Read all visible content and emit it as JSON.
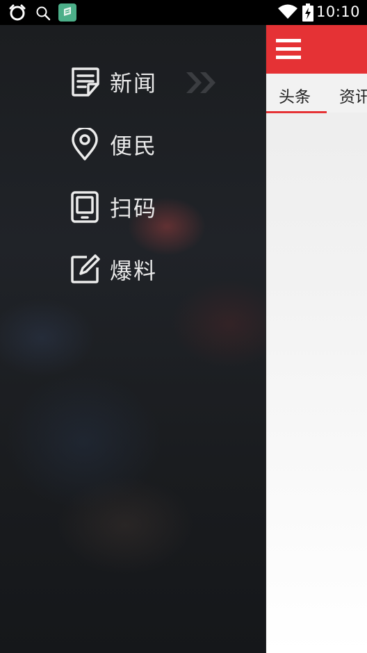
{
  "status_bar": {
    "time": "10:10",
    "icons": [
      "alarm-clock-icon",
      "search-icon",
      "app-notification-icon",
      "wifi-icon",
      "battery-charging-icon"
    ]
  },
  "drawer": {
    "items": [
      {
        "label": "新闻",
        "icon": "news-icon",
        "active": true
      },
      {
        "label": "便民",
        "icon": "location-pin-icon"
      },
      {
        "label": "扫码",
        "icon": "scan-device-icon"
      },
      {
        "label": "爆料",
        "icon": "edit-icon"
      }
    ],
    "active_indicator_icon": "double-chevron-right-icon"
  },
  "main": {
    "menu_icon": "hamburger-menu-icon",
    "tabs": [
      {
        "label": "头条",
        "selected": true
      },
      {
        "label": "资讯"
      }
    ],
    "colors": {
      "accent": "#e53235",
      "drawer_background": "#1e2024"
    }
  }
}
